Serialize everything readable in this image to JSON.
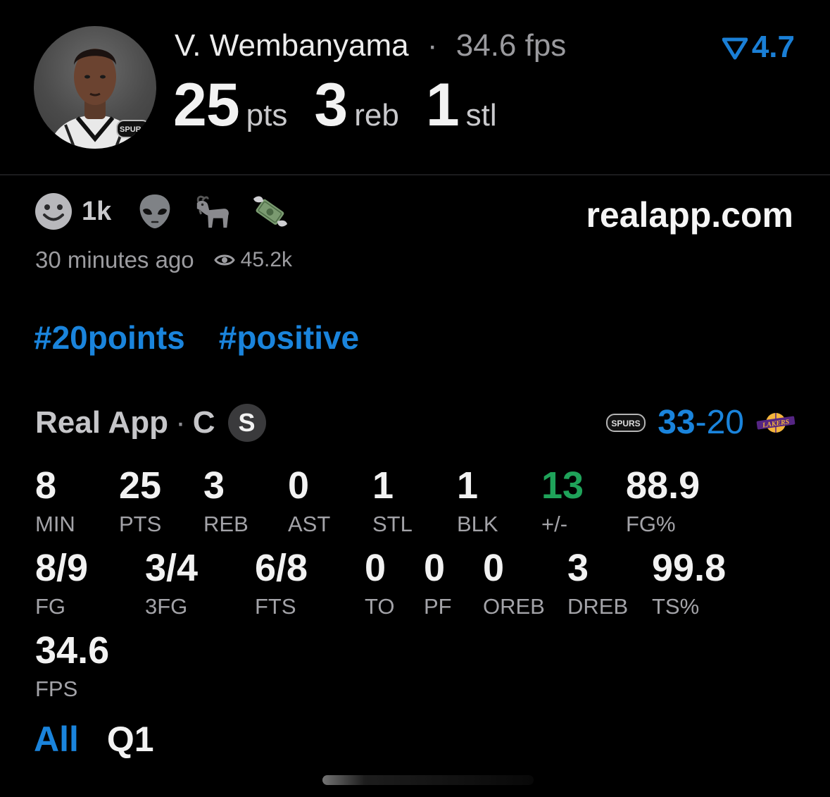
{
  "player": {
    "name": "V. Wembanyama",
    "separator": "·",
    "fps": "34.6 fps",
    "boost_value": "4.7",
    "statline": [
      {
        "value": "25",
        "unit": "pts"
      },
      {
        "value": "3",
        "unit": "reb"
      },
      {
        "value": "1",
        "unit": "stl"
      }
    ],
    "avatar_icon": "player-headshot",
    "team_badge": "SPURS"
  },
  "reactions": {
    "items": [
      {
        "icon": "smiley-face-icon",
        "count": "1k"
      },
      {
        "icon": "alien-icon",
        "count": ""
      },
      {
        "icon": "goat-icon",
        "count": ""
      },
      {
        "icon": "money-wings-icon",
        "count": ""
      }
    ],
    "site": "realapp.com",
    "time_ago": "30 minutes ago",
    "views": "45.2k"
  },
  "hashtags": [
    "#20points",
    "#positive"
  ],
  "game": {
    "source": "Real App",
    "dot": "·",
    "position": "C",
    "team_letter": "S",
    "score_own": "33",
    "score_dash": "-",
    "score_opp": "20",
    "home_team_badge": "SPURS",
    "away_team_badge": "LAKERS"
  },
  "stats_row1": [
    {
      "value": "8",
      "label": "MIN"
    },
    {
      "value": "25",
      "label": "PTS"
    },
    {
      "value": "3",
      "label": "REB"
    },
    {
      "value": "0",
      "label": "AST"
    },
    {
      "value": "1",
      "label": "STL"
    },
    {
      "value": "1",
      "label": "BLK"
    },
    {
      "value": "13",
      "label": "+/-"
    },
    {
      "value": "88.9",
      "label": "FG%"
    }
  ],
  "stats_row2": [
    {
      "value": "8/9",
      "label": "FG"
    },
    {
      "value": "3/4",
      "label": "3FG"
    },
    {
      "value": "6/8",
      "label": "FTS"
    },
    {
      "value": "0",
      "label": "TO"
    },
    {
      "value": "0",
      "label": "PF"
    },
    {
      "value": "0",
      "label": "OREB"
    },
    {
      "value": "3",
      "label": "DREB"
    },
    {
      "value": "99.8",
      "label": "TS%"
    }
  ],
  "stats_row3": [
    {
      "value": "34.6",
      "label": "FPS"
    }
  ],
  "tabs": [
    {
      "label": "All",
      "active": true
    },
    {
      "label": "Q1",
      "active": false
    }
  ],
  "colors": {
    "accent": "#1a84dc",
    "positive": "#1fa35a",
    "background": "#000000"
  }
}
